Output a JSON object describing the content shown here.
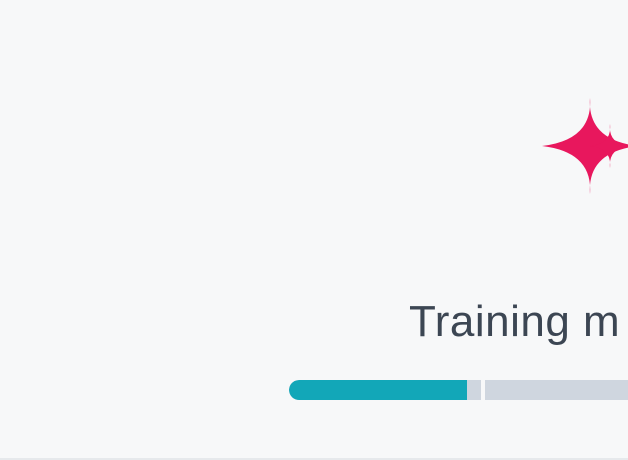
{
  "status": {
    "text": "Training m"
  },
  "progress": {
    "value": 0.445
  },
  "icon": {
    "name": "sparkle-icon",
    "color": "#e8175d"
  },
  "colors": {
    "progress_fill": "#12a7b8",
    "progress_track": "#cfd6df",
    "background": "#f7f8f9",
    "text": "#3c4653"
  }
}
